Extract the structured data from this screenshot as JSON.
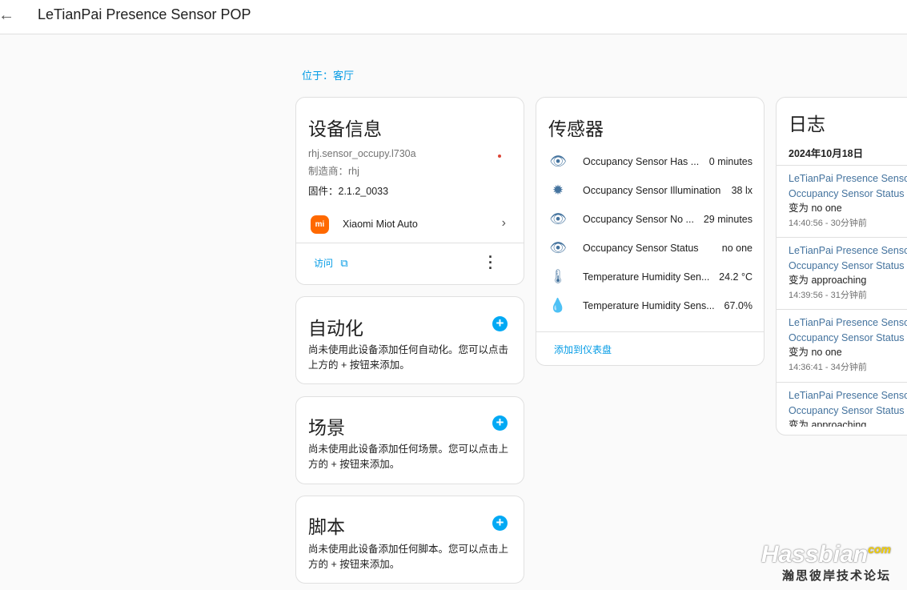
{
  "header": {
    "title": "LeTianPai Presence Sensor POP",
    "back_icon": "arrow-left-icon"
  },
  "location": "位于：客厅",
  "device_info": {
    "title": "设备信息",
    "model": "rhj.sensor_occupy.l730a",
    "manufacturer": "制造商：rhj",
    "firmware": "固件：2.1.2_0033",
    "integration": "Xiaomi Miot Auto",
    "visit": "访问",
    "status_dot_color": "#db4437"
  },
  "automation": {
    "title": "自动化",
    "desc": "尚未使用此设备添加任何自动化。您可以点击上方的 + 按钮来添加。"
  },
  "scene": {
    "title": "场景",
    "desc": "尚未使用此设备添加任何场景。您可以点击上方的 + 按钮来添加。"
  },
  "script": {
    "title": "脚本",
    "desc": "尚未使用此设备添加任何脚本。您可以点击上方的 + 按钮来添加。"
  },
  "sensors": {
    "title": "传感器",
    "add_to_dashboard": "添加到仪表盘",
    "items": [
      {
        "icon": "eye-icon",
        "name": "Occupancy Sensor Has ...",
        "value": "0 minutes"
      },
      {
        "icon": "brightness-icon",
        "name": "Occupancy Sensor Illumination",
        "value": "38 lx"
      },
      {
        "icon": "eye-icon",
        "name": "Occupancy Sensor No ...",
        "value": "29 minutes"
      },
      {
        "icon": "eye-icon",
        "name": "Occupancy Sensor Status",
        "value": "no one"
      },
      {
        "icon": "thermometer-icon",
        "name": "Temperature Humidity Sen...",
        "value": "24.2 °C"
      },
      {
        "icon": "water-percent-icon",
        "name": "Temperature Humidity Sens...",
        "value": "67.0%"
      }
    ]
  },
  "logbook": {
    "title": "日志",
    "date": "2024年10月18日",
    "entries": [
      {
        "device": "LeTianPai Presence Sensor POP",
        "entity": "Occupancy Sensor Status",
        "change": "变为 no one",
        "time": "14:40:56 - 30分钟前"
      },
      {
        "device": "LeTianPai Presence Sensor POP",
        "entity": "Occupancy Sensor Status",
        "change": "变为 approaching",
        "time": "14:39:56 - 31分钟前"
      },
      {
        "device": "LeTianPai Presence Sensor POP",
        "entity": "Occupancy Sensor Status",
        "change": "变为 no one",
        "time": "14:36:41 - 34分钟前"
      },
      {
        "device": "LeTianPai Presence Sensor POP",
        "entity": "Occupancy Sensor Status",
        "change": "变为 approaching",
        "time": ""
      }
    ]
  },
  "watermark": {
    "brand": "Hassbian",
    "tld": "com",
    "subtitle": "瀚思彼岸技术论坛"
  },
  "colors": {
    "accent": "#03a9f4",
    "link": "#039be5",
    "icon": "#44739e",
    "mi": "#ff6900"
  }
}
